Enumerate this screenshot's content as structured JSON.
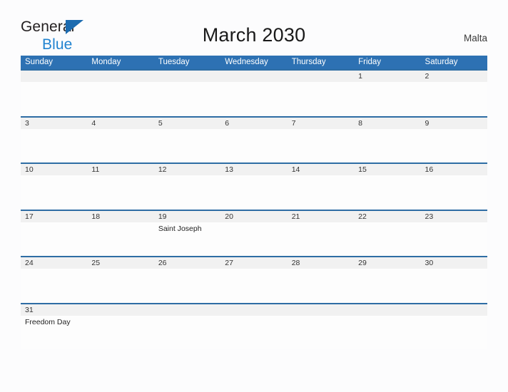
{
  "brand": {
    "word1": "General",
    "word2": "Blue",
    "flag_color": "#1c6bb0",
    "word2_color": "#2183d0"
  },
  "header": {
    "title": "March 2030",
    "country": "Malta"
  },
  "theme": {
    "header_blue": "#2d71b3",
    "row_rule_blue": "#2e6da4",
    "daynum_band": "#f1f1f1",
    "page_background": "#fcfcfd"
  },
  "calendar": {
    "month": "March",
    "year": "2030",
    "weekday_headers": [
      "Sunday",
      "Monday",
      "Tuesday",
      "Wednesday",
      "Thursday",
      "Friday",
      "Saturday"
    ],
    "weeks": [
      [
        {
          "day": "",
          "events": []
        },
        {
          "day": "",
          "events": []
        },
        {
          "day": "",
          "events": []
        },
        {
          "day": "",
          "events": []
        },
        {
          "day": "",
          "events": []
        },
        {
          "day": "1",
          "events": []
        },
        {
          "day": "2",
          "events": []
        }
      ],
      [
        {
          "day": "3",
          "events": []
        },
        {
          "day": "4",
          "events": []
        },
        {
          "day": "5",
          "events": []
        },
        {
          "day": "6",
          "events": []
        },
        {
          "day": "7",
          "events": []
        },
        {
          "day": "8",
          "events": []
        },
        {
          "day": "9",
          "events": []
        }
      ],
      [
        {
          "day": "10",
          "events": []
        },
        {
          "day": "11",
          "events": []
        },
        {
          "day": "12",
          "events": []
        },
        {
          "day": "13",
          "events": []
        },
        {
          "day": "14",
          "events": []
        },
        {
          "day": "15",
          "events": []
        },
        {
          "day": "16",
          "events": []
        }
      ],
      [
        {
          "day": "17",
          "events": []
        },
        {
          "day": "18",
          "events": []
        },
        {
          "day": "19",
          "events": [
            "Saint Joseph"
          ]
        },
        {
          "day": "20",
          "events": []
        },
        {
          "day": "21",
          "events": []
        },
        {
          "day": "22",
          "events": []
        },
        {
          "day": "23",
          "events": []
        }
      ],
      [
        {
          "day": "24",
          "events": []
        },
        {
          "day": "25",
          "events": []
        },
        {
          "day": "26",
          "events": []
        },
        {
          "day": "27",
          "events": []
        },
        {
          "day": "28",
          "events": []
        },
        {
          "day": "29",
          "events": []
        },
        {
          "day": "30",
          "events": []
        }
      ],
      [
        {
          "day": "31",
          "events": [
            "Freedom Day"
          ]
        },
        {
          "day": "",
          "events": []
        },
        {
          "day": "",
          "events": []
        },
        {
          "day": "",
          "events": []
        },
        {
          "day": "",
          "events": []
        },
        {
          "day": "",
          "events": []
        },
        {
          "day": "",
          "events": []
        }
      ]
    ]
  }
}
